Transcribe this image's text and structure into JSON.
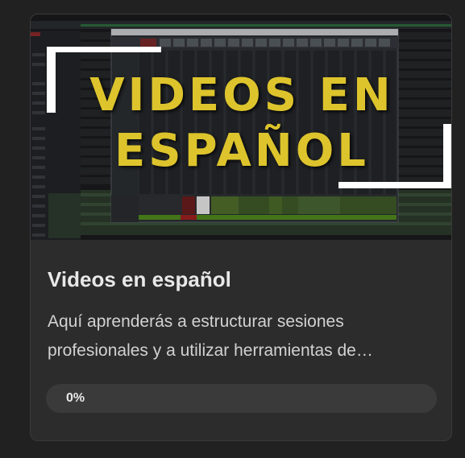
{
  "course": {
    "thumbnail_title_line1": "VIDEOS EN",
    "thumbnail_title_line2": "ESPAÑOL",
    "title": "Videos en español",
    "description": "Aquí aprenderás a estructurar sesiones profesionales y a utilizar herramientas de…",
    "progress_label": "0%",
    "progress_fraction": 0
  },
  "colors": {
    "background": "#212121",
    "card": "#2c2c2c",
    "thumbnail_text": "#ddc42c",
    "progress_track": "#3a3a3a"
  }
}
